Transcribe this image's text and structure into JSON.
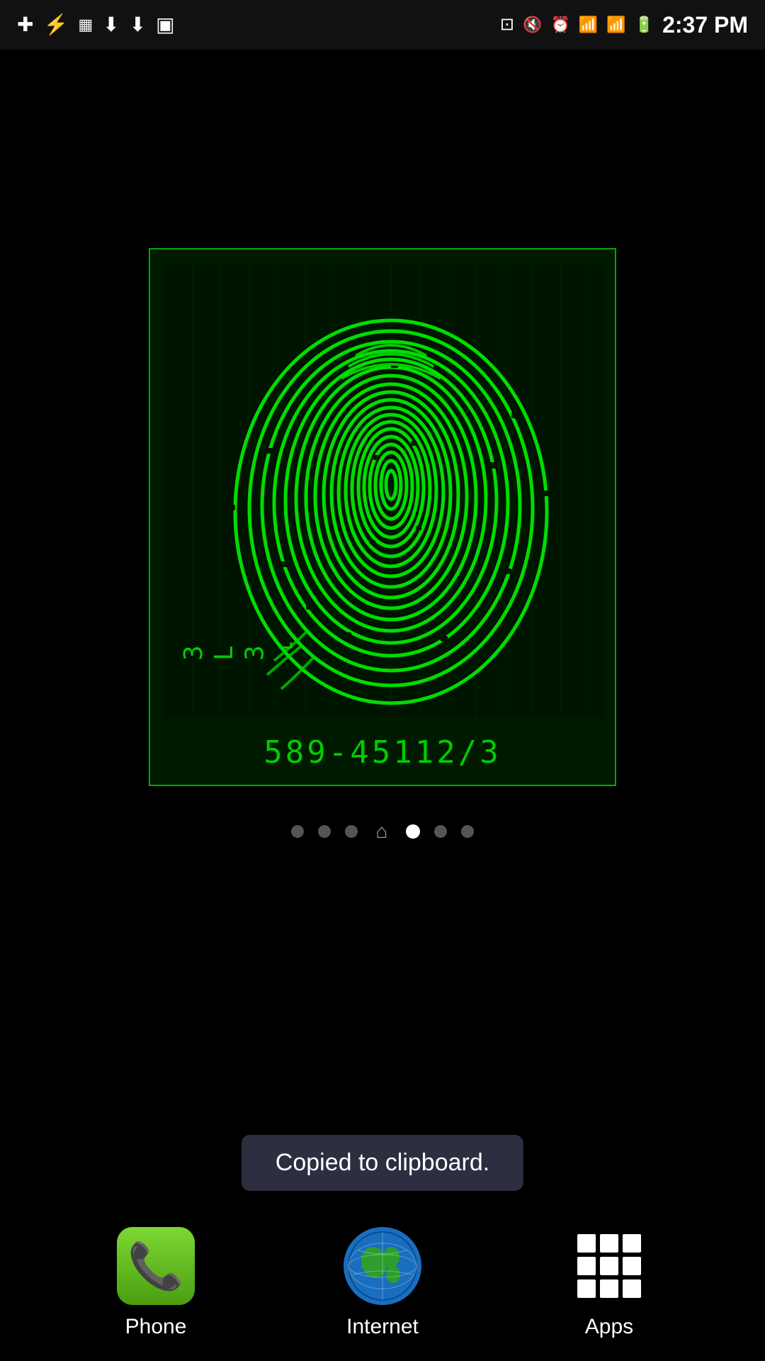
{
  "statusBar": {
    "time": "2:37 PM",
    "iconsLeft": [
      "+",
      "USB",
      "SIM",
      "↓",
      "↓",
      "IMG"
    ],
    "iconsRight": [
      "NFC",
      "MUTE",
      "ALARM",
      "WIFI",
      "SIGNAL",
      "BATTERY"
    ]
  },
  "fingerprintWidget": {
    "sideText": "3\nL\n3",
    "code": "589-45112/3"
  },
  "pageIndicators": {
    "dots": [
      "dot",
      "dot",
      "dot",
      "home",
      "active",
      "dot",
      "dot"
    ],
    "activeIndex": 4,
    "homeIndex": 3
  },
  "dock": {
    "items": [
      {
        "id": "phone",
        "label": "Phone"
      },
      {
        "id": "internet",
        "label": "Internet"
      },
      {
        "id": "apps",
        "label": "Apps"
      }
    ]
  },
  "toast": {
    "message": "Copied to clipboard."
  }
}
